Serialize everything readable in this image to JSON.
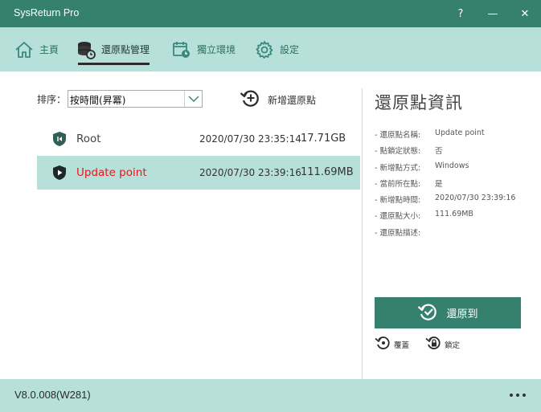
{
  "window": {
    "title": "SysReturn Pro",
    "help_label": "?",
    "minimize_label": "—",
    "close_label": "✕"
  },
  "nav": {
    "tabs": [
      {
        "label": "主頁",
        "icon": "home-icon",
        "active": false
      },
      {
        "label": "還原點管理",
        "icon": "database-restore-icon",
        "active": true
      },
      {
        "label": "獨立環境",
        "icon": "calendar-clock-icon",
        "active": false
      },
      {
        "label": "設定",
        "icon": "gear-icon",
        "active": false
      }
    ]
  },
  "toolbar": {
    "sort_label": "排序：",
    "sort_value": "按時間(昇冪)",
    "add_label": "新增還原點"
  },
  "snapshots": [
    {
      "name": "Root",
      "time": "2020/07/30 23:35:14",
      "size": "17.71GB",
      "selected": false,
      "icon": "shield-skip-icon"
    },
    {
      "name": "Update point",
      "time": "2020/07/30 23:39:16",
      "size": "111.69MB",
      "selected": true,
      "icon": "shield-play-icon"
    }
  ],
  "info": {
    "title": "還原點資訊",
    "rows": [
      {
        "key": "- 還原點名稱:",
        "value": "Update point"
      },
      {
        "key": "- 點鎖定狀態:",
        "value": "否"
      },
      {
        "key": "- 新增點方式:",
        "value": "Windows"
      },
      {
        "key": "- 當前所在點:",
        "value": "是"
      },
      {
        "key": "- 新增點時間:",
        "value": "2020/07/30 23:39:16"
      },
      {
        "key": "- 還原點大小:",
        "value": "111.69MB"
      },
      {
        "key": "- 還原點描述:",
        "value": ""
      }
    ],
    "restore_label": "還原到",
    "overwrite_label": "覆蓋",
    "lock_label": "鎖定"
  },
  "status": {
    "version": "V8.0.008(W281)"
  },
  "colors": {
    "titlebar": "#36806f",
    "accent": "#b7e0da",
    "selected_text": "#e01b1b"
  }
}
